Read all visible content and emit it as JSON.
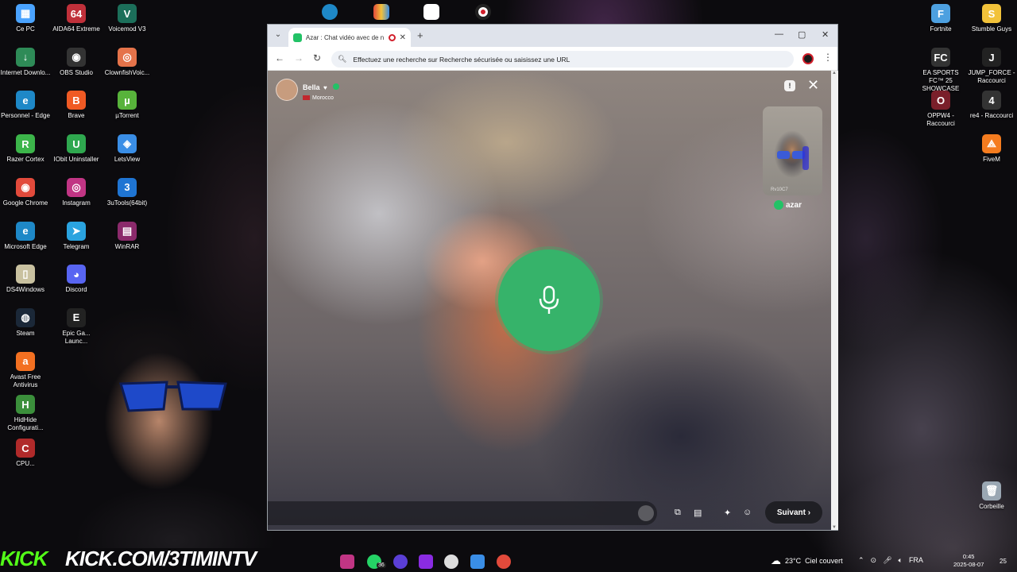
{
  "desktop": {
    "left_icons": [
      {
        "label": "Ce PC",
        "glyph": "▦",
        "color": "#4aa3ff"
      },
      {
        "label": "AIDA64 Extreme",
        "glyph": "64",
        "color": "#c0303a"
      },
      {
        "label": "Voicemod V3",
        "glyph": "V",
        "color": "#1c6f5a"
      },
      {
        "label": "Internet Downlo...",
        "glyph": "↓",
        "color": "#2e8b57"
      },
      {
        "label": "OBS Studio",
        "glyph": "◉",
        "color": "#333"
      },
      {
        "label": "ClownfishVoic...",
        "glyph": "◎",
        "color": "#e5734a"
      },
      {
        "label": "Personnel - Edge",
        "glyph": "e",
        "color": "#1e88c7"
      },
      {
        "label": "Brave",
        "glyph": "B",
        "color": "#f05a24"
      },
      {
        "label": "µTorrent",
        "glyph": "µ",
        "color": "#58b33b"
      },
      {
        "label": "Razer Cortex",
        "glyph": "R",
        "color": "#3cb54a"
      },
      {
        "label": "IObit Uninstaller",
        "glyph": "U",
        "color": "#2fa84f"
      },
      {
        "label": "LetsView",
        "glyph": "◈",
        "color": "#3a8ee6"
      },
      {
        "label": "Google Chrome",
        "glyph": "◉",
        "color": "#e24a3b"
      },
      {
        "label": "Instagram",
        "glyph": "◎",
        "color": "#c13584"
      },
      {
        "label": "3uTools(64bit)",
        "glyph": "3",
        "color": "#1f75d3"
      },
      {
        "label": "Microsoft Edge",
        "glyph": "e",
        "color": "#1e88c7"
      },
      {
        "label": "Telegram",
        "glyph": "➤",
        "color": "#2aa3df"
      },
      {
        "label": "WinRAR",
        "glyph": "▤",
        "color": "#8b2a6b"
      },
      {
        "label": "DS4Windows",
        "glyph": "▯",
        "color": "#c9c1a0"
      },
      {
        "label": "Discord",
        "glyph": "◕",
        "color": "#5865f2"
      },
      {
        "label": "Epic Ga... Launc...",
        "glyph": "E",
        "color": "#222"
      },
      {
        "label": "Steam",
        "glyph": "◍",
        "color": "#1b2838"
      },
      {
        "label": "Avast Free Antivirus",
        "glyph": "a",
        "color": "#f37021"
      },
      {
        "label": "HidHide Configurati...",
        "glyph": "H",
        "color": "#3b8f3b"
      },
      {
        "label": "CPU...",
        "glyph": "C",
        "color": "#b02a2a"
      }
    ],
    "right_icons": [
      {
        "label": "Fortnite",
        "glyph": "F",
        "color": "#4da0e0"
      },
      {
        "label": "Stumble Guys",
        "glyph": "S",
        "color": "#f2c23a"
      },
      {
        "label": "EA SPORTS FC™ 25 SHOWCASE",
        "glyph": "FC",
        "color": "#333"
      },
      {
        "label": "JUMP_FORCE - Raccourci",
        "glyph": "J",
        "color": "#222"
      },
      {
        "label": "OPPW4 - Raccourci",
        "glyph": "O",
        "color": "#7a1f2a"
      },
      {
        "label": "re4 - Raccourci",
        "glyph": "4",
        "color": "#333"
      },
      {
        "label": "FiveM",
        "glyph": "⟁",
        "color": "#f57c1f"
      },
      {
        "label": "Corbeille",
        "glyph": "🗑",
        "color": "#9aa7b3"
      }
    ]
  },
  "browser": {
    "tab_title": "Azar : Chat vidéo avec de n",
    "tab_close": "✕",
    "new_tab": "+",
    "minimize": "—",
    "maximize": "▢",
    "close": "✕",
    "back": "←",
    "forward": "→",
    "reload": "↻",
    "omnibox_text": "Effectuez une recherche sur Recherche sécurisée ou saisissez une URL",
    "menu": "⋮"
  },
  "azar": {
    "partner_name": "Bella",
    "partner_heart": "♥",
    "partner_country": "Morocco",
    "report": "!",
    "close": "✕",
    "self_tag": "Rv10C7",
    "logo_text": "azar",
    "next_label": "Suivant ›",
    "colors": {
      "accent": "#36b36a",
      "brand": "#22c266"
    }
  },
  "overlay": {
    "kick_logo": "KICK",
    "kick_url": "KICK.COM/3TIMINTV"
  },
  "taskbar": {
    "weather_temp": "23°C",
    "weather_text": "Ciel couvert",
    "language": "FRA",
    "time": "0:45",
    "date": "2025-08-07",
    "whatsapp_badge": "36",
    "notification_count": "25"
  }
}
